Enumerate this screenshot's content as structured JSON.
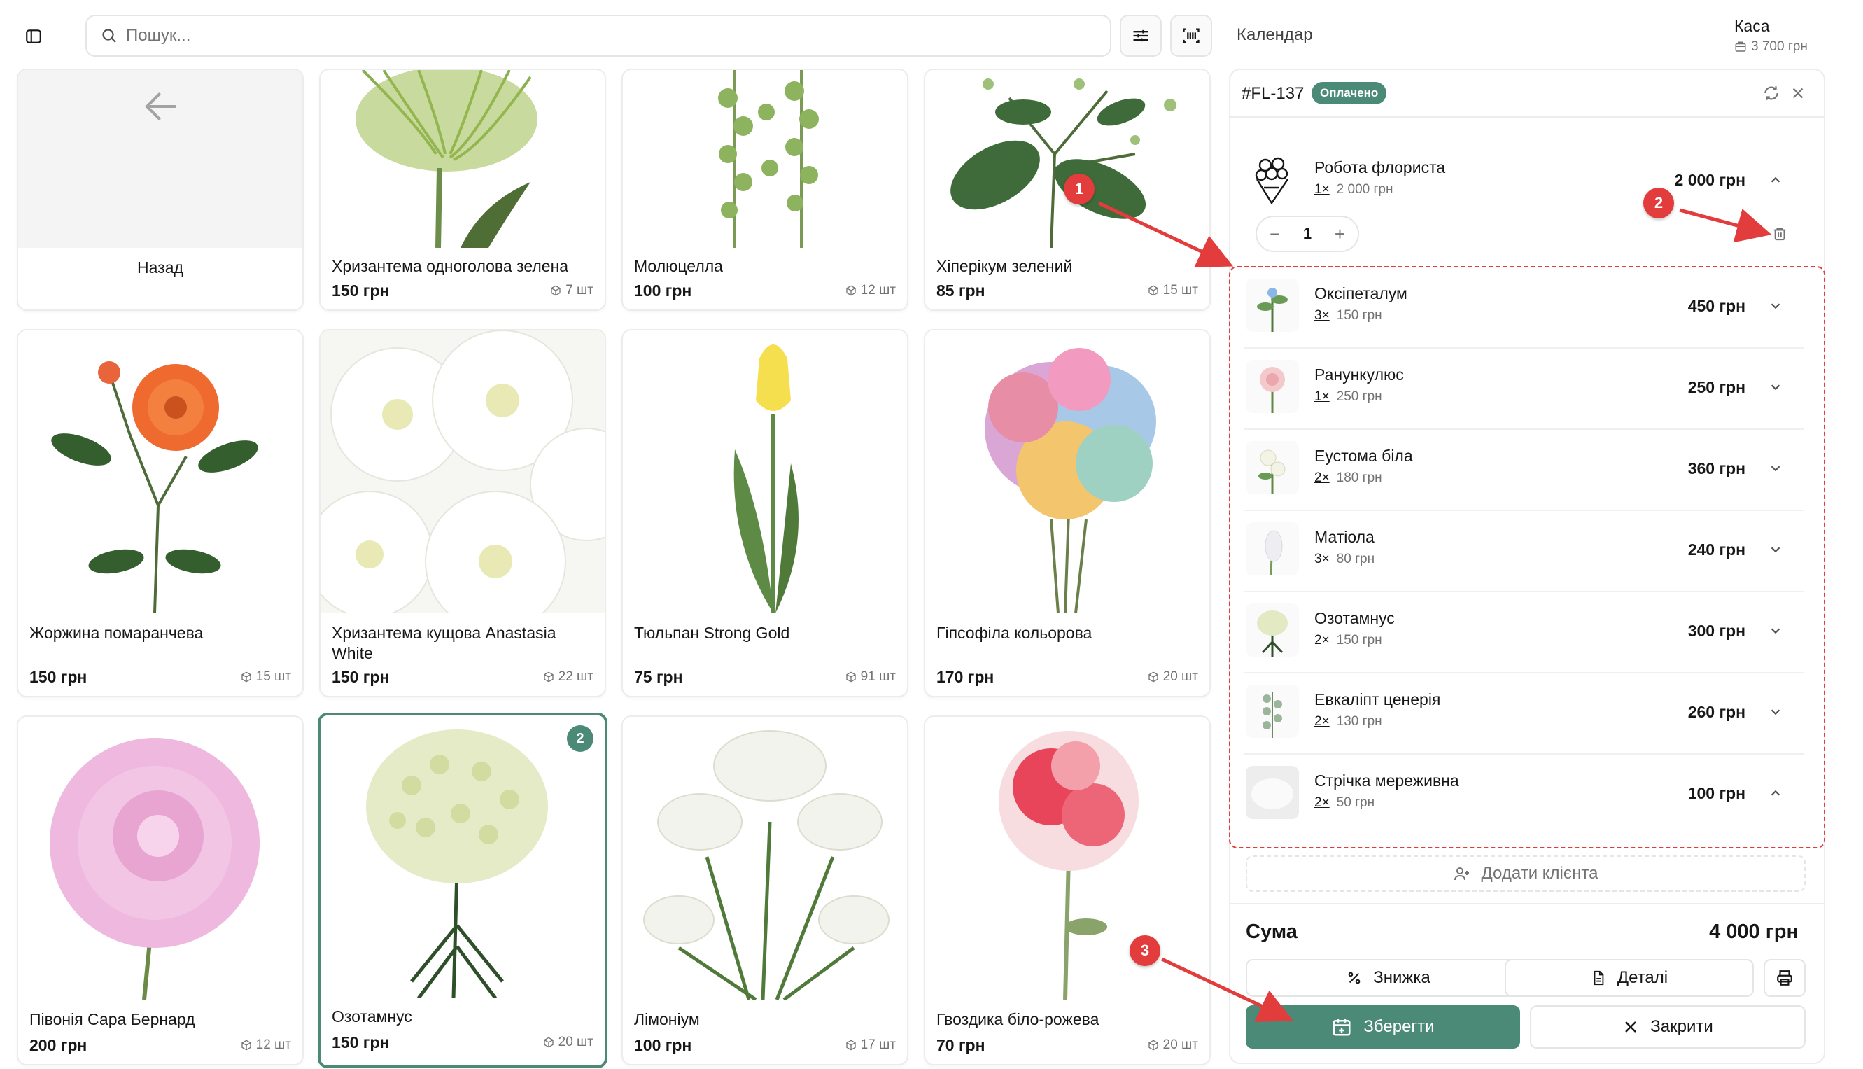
{
  "search": {
    "placeholder": "Пошук..."
  },
  "header": {
    "calendar": "Календар",
    "cashbox_title": "Каса",
    "cashbox_amount": "3 700 грн"
  },
  "products": [
    {
      "name": "Назад",
      "price": "",
      "stock": ""
    },
    {
      "name": "Хризантема одноголова зелена",
      "price": "150 грн",
      "stock": "7 шт"
    },
    {
      "name": "Молюцелла",
      "price": "100 грн",
      "stock": "12 шт"
    },
    {
      "name": "Хіперікум зелений",
      "price": "85 грн",
      "stock": "15 шт"
    },
    {
      "name": "Жоржина помаранчева",
      "price": "150 грн",
      "stock": "15 шт"
    },
    {
      "name": "Хризантема кущова Anastasia White",
      "price": "150 грн",
      "stock": "22 шт"
    },
    {
      "name": "Тюльпан Strong Gold",
      "price": "75 грн",
      "stock": "91 шт"
    },
    {
      "name": "Гіпсофіла кольорова",
      "price": "170 грн",
      "stock": "20 шт"
    },
    {
      "name": "Півонія Сара Бернард",
      "price": "200 грн",
      "stock": "12 шт"
    },
    {
      "name": "Озотамнус",
      "price": "150 грн",
      "stock": "20 шт",
      "badge": "2"
    },
    {
      "name": "Лімоніум",
      "price": "100 грн",
      "stock": "17 шт"
    },
    {
      "name": "Гвоздика біло-рожева",
      "price": "70 грн",
      "stock": "20 шт"
    }
  ],
  "order": {
    "id": "#FL-137",
    "status": "Оплачено",
    "florist": {
      "name": "Робота флориста",
      "qty": "1×",
      "unit_price": "2 000 грн",
      "total": "2 000 грн",
      "stepper_value": "1"
    },
    "items": [
      {
        "name": "Оксіпеталум",
        "qty": "3×",
        "unit_price": "150 грн",
        "total": "450 грн"
      },
      {
        "name": "Ранункулюс",
        "qty": "1×",
        "unit_price": "250 грн",
        "total": "250 грн"
      },
      {
        "name": "Еустома біла",
        "qty": "2×",
        "unit_price": "180 грн",
        "total": "360 грн"
      },
      {
        "name": "Матіола",
        "qty": "3×",
        "unit_price": "80 грн",
        "total": "240 грн"
      },
      {
        "name": "Озотамнус",
        "qty": "2×",
        "unit_price": "150 грн",
        "total": "300 грн"
      },
      {
        "name": "Евкаліпт ценерія",
        "qty": "2×",
        "unit_price": "130 грн",
        "total": "260 грн"
      },
      {
        "name": "Стрічка мереживна",
        "qty": "2×",
        "unit_price": "50 грн",
        "total": "100 грн"
      }
    ],
    "add_client": "Додати клієнта",
    "sum_label": "Сума",
    "sum_total": "4 000 грн",
    "discount": "Знижка",
    "details": "Деталі",
    "save": "Зберегти",
    "close": "Закрити"
  },
  "annotations": [
    "1",
    "2",
    "3"
  ],
  "colors": {
    "accent": "#4a8a76",
    "annotation": "#e23c3c"
  }
}
